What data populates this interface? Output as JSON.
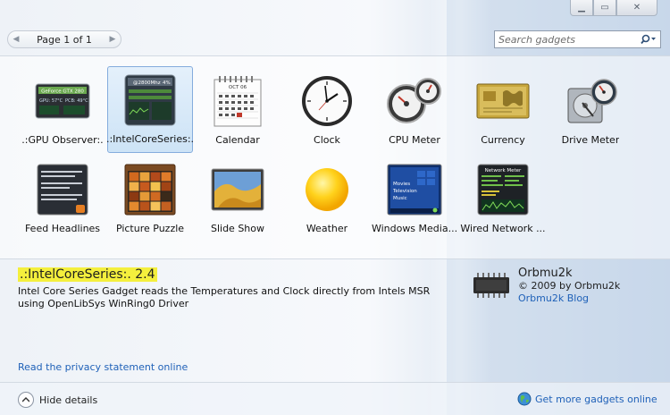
{
  "window": {
    "buttons": {
      "minimize": "▁",
      "maximize": "▭",
      "close": "✕"
    }
  },
  "pager": {
    "label": "Page 1 of 1",
    "prev_icon": "◀",
    "next_icon": "▶"
  },
  "search": {
    "placeholder": "Search gadgets",
    "icon": "search-icon",
    "dropdown": "▾"
  },
  "gadgets": [
    {
      "name": ".:GPU Observer:.",
      "icon": "gpu-observer-icon",
      "selected": false
    },
    {
      "name": ".:IntelCoreSeries:.",
      "icon": "intel-core-series-icon",
      "selected": true
    },
    {
      "name": "Calendar",
      "icon": "calendar-icon",
      "selected": false
    },
    {
      "name": "Clock",
      "icon": "clock-icon",
      "selected": false
    },
    {
      "name": "CPU Meter",
      "icon": "cpu-meter-icon",
      "selected": false
    },
    {
      "name": "Currency",
      "icon": "currency-icon",
      "selected": false
    },
    {
      "name": "Drive Meter",
      "icon": "drive-meter-icon",
      "selected": false
    },
    {
      "name": "Feed Headlines",
      "icon": "feed-headlines-icon",
      "selected": false
    },
    {
      "name": "Picture Puzzle",
      "icon": "picture-puzzle-icon",
      "selected": false
    },
    {
      "name": "Slide Show",
      "icon": "slide-show-icon",
      "selected": false
    },
    {
      "name": "Weather",
      "icon": "weather-icon",
      "selected": false
    },
    {
      "name": "Windows Media...",
      "icon": "windows-media-icon",
      "selected": false
    },
    {
      "name": "Wired Network ...",
      "icon": "network-meter-icon",
      "selected": false
    }
  ],
  "thumb_text": {
    "gpu_top": "GeForce GTX 280",
    "gpu_l1": "GPU: 57°C",
    "gpu_l2": "PCB: 49°C",
    "intel_top": "@2800Mhz",
    "intel_pct": "4%",
    "cal_month": "OCT 06",
    "media_l1": "Movies",
    "media_l2": "Television",
    "media_l3": "Music",
    "net_title": "Network Meter"
  },
  "details": {
    "title": ".:IntelCoreSeries:. 2.4",
    "description": "Intel Core Series Gadget reads the Temperatures and Clock directly from Intels MSR using OpenLibSys WinRing0 Driver",
    "privacy_link": "Read the privacy statement online",
    "publisher": {
      "name": "Orbmu2k",
      "copyright": "© 2009 by Orbmu2k",
      "link": "Orbmu2k Blog",
      "icon": "chip-icon"
    }
  },
  "footer": {
    "hide_label": "Hide details",
    "hide_icon": "chevron-up-icon",
    "more_label": "Get more gadgets online",
    "more_icon": "globe-icon"
  },
  "colors": {
    "highlight": "#f4ef3d",
    "link": "#1f61b8",
    "selection": "#cde3f6"
  }
}
